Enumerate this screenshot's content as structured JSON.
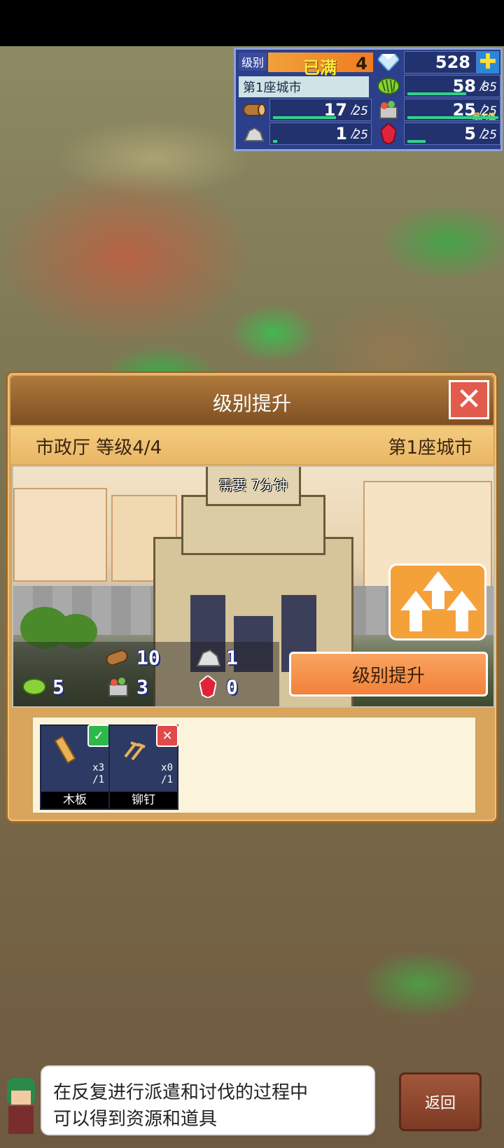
{
  "hud": {
    "level_label": "级别",
    "level_status": "已满",
    "level_value": "4",
    "city": "第1座城市",
    "gems": "528",
    "food": {
      "current": "58",
      "max": "85",
      "fill": 0.68
    },
    "wood": {
      "current": "17",
      "max": "25",
      "fill": 0.68
    },
    "villagers": {
      "current": "25",
      "max": "25",
      "note": "最大值",
      "fill": 1.0
    },
    "ore": {
      "current": "1",
      "max": "25",
      "fill": 0.04
    },
    "ruby": {
      "current": "5",
      "max": "25",
      "fill": 0.2
    },
    "slash": "/"
  },
  "dialog": {
    "title": "级别提升",
    "building": "市政厅 等级4/4",
    "city": "第1座城市",
    "time_required": "需要 7分钟",
    "costs": {
      "wood": "10",
      "ore": "1",
      "food": "5",
      "villagers": "3",
      "ruby": "0"
    },
    "upgrade_button": "级别提升",
    "materials": [
      {
        "label": "木板",
        "count_line1": "x3",
        "count_line2": "/1",
        "status": "ok"
      },
      {
        "label": "铆钉",
        "count_line1": "x0",
        "count_line2": "/1",
        "status": "no"
      }
    ]
  },
  "hint": {
    "line1": "在反复进行派遣和讨伐的过程中",
    "line2": "可以得到资源和道具"
  },
  "back_button": "返回",
  "colors": {
    "hud_bg": "#2b3f8a",
    "dialog_bg": "#d9a45b",
    "upgrade_button": "#f2813a",
    "close_button": "#e35b4d"
  }
}
